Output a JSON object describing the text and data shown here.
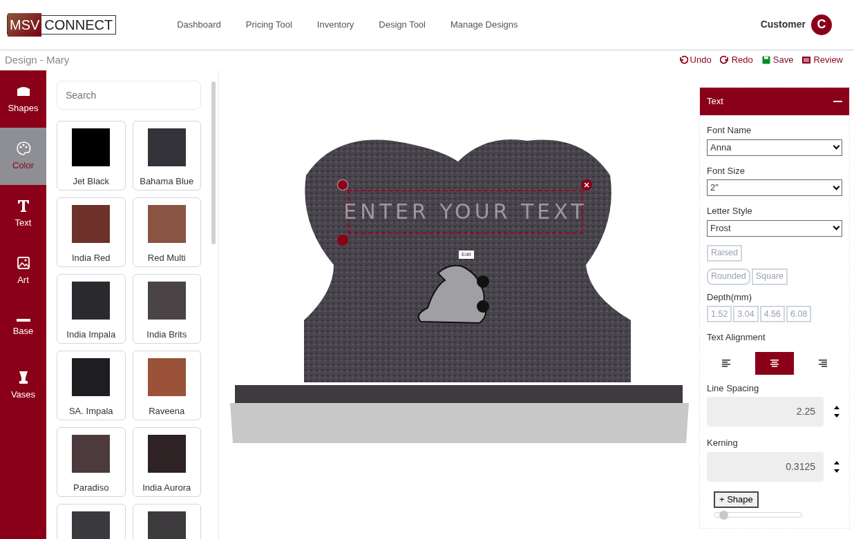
{
  "logo": {
    "left": "MSV",
    "right": "CONNECT"
  },
  "nav": [
    {
      "label": "Dashboard"
    },
    {
      "label": "Pricing Tool"
    },
    {
      "label": "Inventory"
    },
    {
      "label": "Design Tool"
    },
    {
      "label": "Manage Designs"
    }
  ],
  "user": {
    "name": "Customer",
    "initial": "C"
  },
  "design_title": "Design - Mary",
  "actions": [
    {
      "kind": "undo",
      "label": "Undo"
    },
    {
      "kind": "redo",
      "label": "Redo"
    },
    {
      "kind": "save",
      "label": "Save"
    },
    {
      "kind": "review",
      "label": "Review"
    }
  ],
  "sidebar": {
    "items": [
      {
        "kind": "shapes",
        "label": "Shapes",
        "selected": false
      },
      {
        "kind": "color",
        "label": "Color",
        "selected": true
      },
      {
        "kind": "text",
        "label": "Text",
        "selected": false
      },
      {
        "kind": "art",
        "label": "Art",
        "selected": false
      },
      {
        "kind": "base",
        "label": "Base",
        "selected": false
      },
      {
        "kind": "vases",
        "label": "Vases",
        "selected": false
      }
    ]
  },
  "swatches": {
    "search_placeholder": "Search",
    "items": [
      {
        "name": "Jet Black",
        "color": "#000000"
      },
      {
        "name": "Bahama Blue",
        "color": "#34333a"
      },
      {
        "name": "India Red",
        "color": "#6e3129"
      },
      {
        "name": "Red Multi",
        "color": "#8a5443"
      },
      {
        "name": "India Impala",
        "color": "#2a2a2e"
      },
      {
        "name": "India Brits",
        "color": "#4a4446"
      },
      {
        "name": "SA. Impala",
        "color": "#1e1e22"
      },
      {
        "name": "Raveena",
        "color": "#9a5238"
      },
      {
        "name": "Paradiso",
        "color": "#4c3a3c"
      },
      {
        "name": "India Aurora",
        "color": "#2e2224"
      },
      {
        "color": "#3a3a3e"
      },
      {
        "color": "#3c3a3c"
      }
    ]
  },
  "canvas": {
    "text": "ENTER YOUR TEXT",
    "art_tag": "Edit"
  },
  "text_panel": {
    "title": "Text",
    "font_name_label": "Font Name",
    "font_name": "Anna",
    "font_size_label": "Font Size",
    "font_size": "2\"",
    "letter_style_label": "Letter Style",
    "letter_style": "Frost",
    "styles": [
      {
        "label": "Raised",
        "disabled": true
      },
      {
        "label": "Rounded",
        "disabled": true
      },
      {
        "label": "Square",
        "disabled": true
      }
    ],
    "depth_label": "Depth(mm)",
    "depths": [
      {
        "label": "1.52",
        "disabled": true
      },
      {
        "label": "3.04",
        "disabled": true
      },
      {
        "label": "4.56",
        "disabled": true
      },
      {
        "label": "6.08",
        "disabled": true
      }
    ],
    "alignment_label": "Text Alignment",
    "alignments": [
      {
        "kind": "left",
        "selected": false
      },
      {
        "kind": "center",
        "selected": true
      },
      {
        "kind": "right",
        "selected": false
      }
    ],
    "line_spacing_label": "Line Spacing",
    "line_spacing": "2.25",
    "kerning_label": "Kerning",
    "kerning": "0.3125",
    "shape_button": "+ Shape",
    "shape_slider": {
      "level": 0.1
    }
  }
}
